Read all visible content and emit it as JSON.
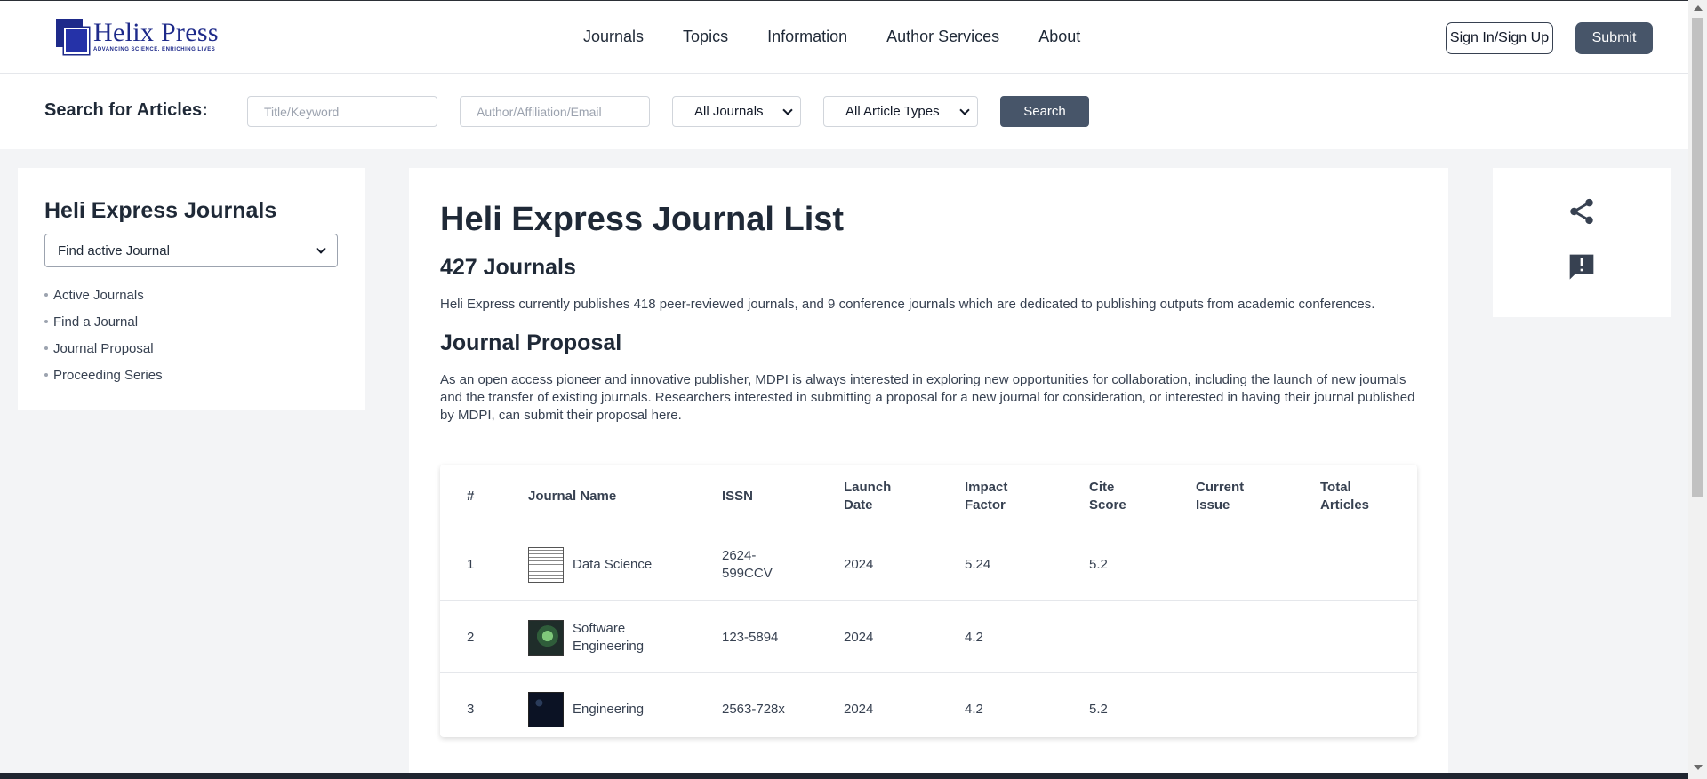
{
  "brand": {
    "name": "Helix Press",
    "tagline": "ADVANCING SCIENCE. ENRICHING LIVES",
    "color": "#1e2a8a"
  },
  "nav": {
    "items": [
      "Journals",
      "Topics",
      "Information",
      "Author Services",
      "About"
    ],
    "signin_label": "Sign In/Sign Up",
    "submit_label": "Submit"
  },
  "search": {
    "label": "Search for Articles:",
    "title_placeholder": "Title/Keyword",
    "author_placeholder": "Author/Affiliation/Email",
    "journal_select": "All Journals",
    "type_select": "All Article Types",
    "button_label": "Search"
  },
  "sidebar": {
    "title": "Heli Express Journals",
    "select_value": "Find active Journal",
    "links": [
      "Active Journals",
      "Find a Journal",
      "Journal Proposal",
      "Proceeding Series"
    ]
  },
  "main": {
    "title": "Heli Express Journal List",
    "count": "427 Journals",
    "description": "Heli Express currently publishes 418 peer-reviewed journals, and 9 conference journals which are dedicated to publishing outputs from academic conferences.",
    "proposal_title": "Journal Proposal",
    "proposal_text": "As an open access pioneer and innovative publisher, MDPI is always interested in exploring new opportunities for collaboration, including the launch of new journals and the transfer of existing journals. Researchers interested in submitting a proposal for a new journal for consideration, or interested in having their journal published by MDPI, can submit their proposal here."
  },
  "table": {
    "headers": {
      "num": "#",
      "name": "Journal Name",
      "issn": "ISSN",
      "launch_1": "Launch",
      "launch_2": "Date",
      "impact_1": "Impact",
      "impact_2": "Factor",
      "cite_1": "Cite",
      "cite_2": "Score",
      "current_1": "Current",
      "current_2": "Issue",
      "total_1": "Total",
      "total_2": "Articles"
    },
    "rows": [
      {
        "num": "1",
        "name": "Data Science",
        "issn": "2624-599CCV",
        "launch": "2024",
        "impact": "5.24",
        "cite": "5.2",
        "current": "",
        "total": ""
      },
      {
        "num": "2",
        "name": "Software Engineering",
        "issn": "123-5894",
        "launch": "2024",
        "impact": "4.2",
        "cite": "",
        "current": "",
        "total": ""
      },
      {
        "num": "3",
        "name": "Engineering",
        "issn": "2563-728x",
        "launch": "2024",
        "impact": "4.2",
        "cite": "5.2",
        "current": "",
        "total": ""
      }
    ]
  },
  "right_panel": {
    "icons": [
      "share-icon",
      "feedback-icon"
    ]
  }
}
